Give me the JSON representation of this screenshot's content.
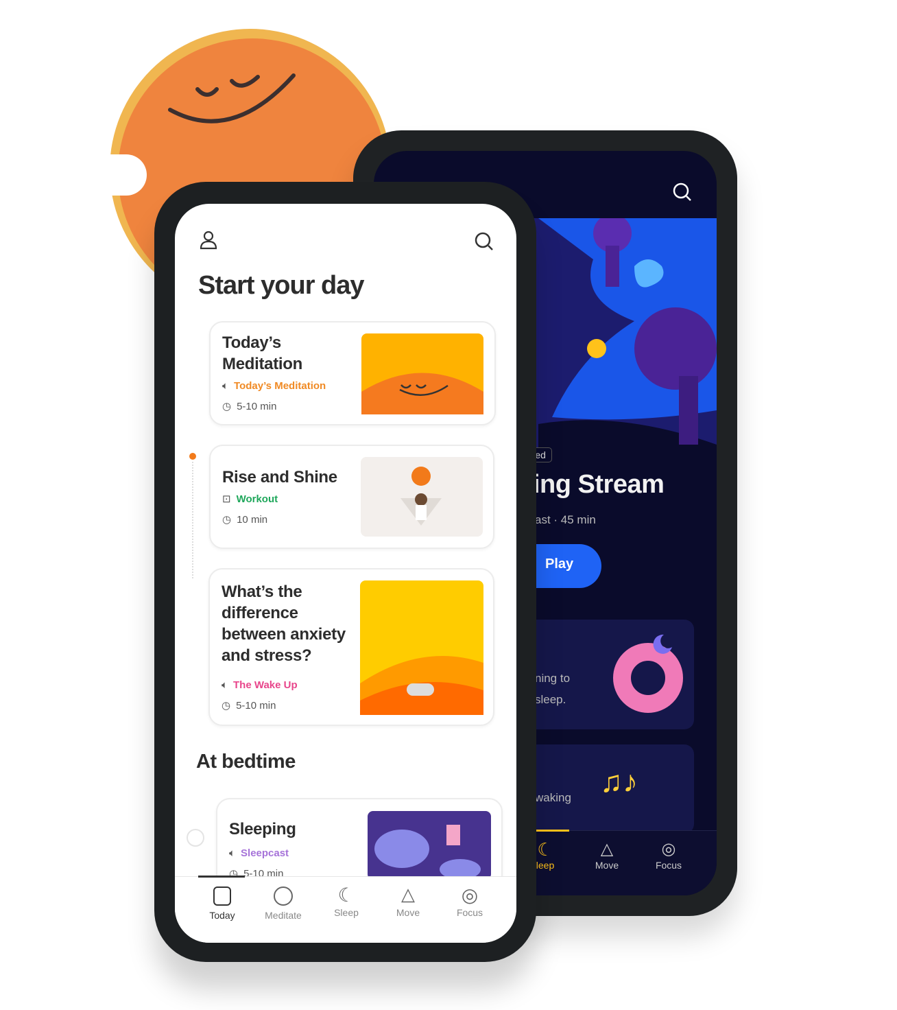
{
  "front": {
    "title": "Start your day",
    "cards": [
      {
        "title": "Today’s Meditation",
        "type": "Today’s Meditation",
        "type_color": "#f08a24",
        "duration": "5-10 min"
      },
      {
        "title": "Rise and Shine",
        "type": "Workout",
        "type_color": "#1fa75b",
        "duration": "10 min"
      },
      {
        "title": "What’s the difference between anxiety and stress?",
        "type": "The Wake Up",
        "type_color": "#e8458b",
        "duration": "5-10 min"
      }
    ],
    "bedtime_title": "At bedtime",
    "bedtime_card": {
      "title": "Sleeping",
      "type": "Sleepcast",
      "type_color": "#a673d9",
      "duration": "5-10 min"
    },
    "nav": [
      "Today",
      "Meditate",
      "Sleep",
      "Move",
      "Focus"
    ]
  },
  "back": {
    "tag": "tured",
    "title": "ing Stream",
    "subtitle": "ast · 45 min",
    "play": "Play",
    "card1": [
      "ning to",
      "sleep."
    ],
    "card2": "waking",
    "nav": [
      "leep",
      "Move",
      "Focus"
    ],
    "accent": "#1f63f5"
  }
}
